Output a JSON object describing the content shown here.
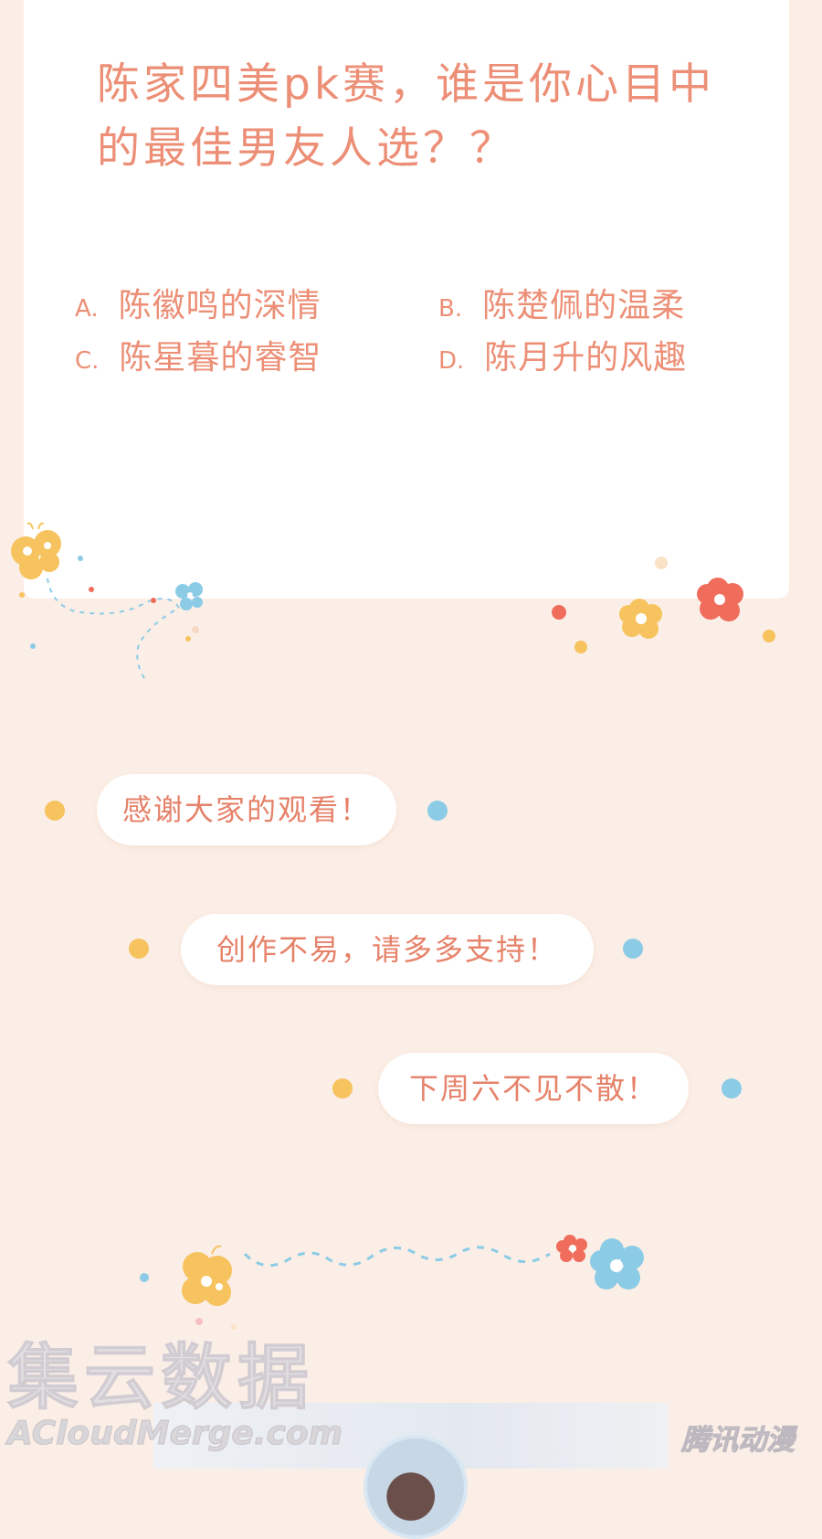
{
  "question": {
    "line1": "陈家四美pk赛，谁是你心目中",
    "line2": "的最佳男友人选？？"
  },
  "options": [
    {
      "letter": "A.",
      "text": "陈徽鸣的深情"
    },
    {
      "letter": "B.",
      "text": "陈楚佩的温柔"
    },
    {
      "letter": "C.",
      "text": "陈星暮的睿智"
    },
    {
      "letter": "D.",
      "text": "陈月升的风趣"
    }
  ],
  "messages": [
    "感谢大家的观看！",
    "创作不易，请多多支持！",
    "下周六不见不散！"
  ],
  "watermark": {
    "title": "集云数据",
    "subtitle": "ACloudMerge.com"
  },
  "brand": "腾讯动漫",
  "colors": {
    "background": "#fbeee6",
    "text_coral": "#ec8f76",
    "dot_yellow": "#f6c35e",
    "dot_blue": "#8ccbe6",
    "flower_red": "#f06d5c"
  }
}
